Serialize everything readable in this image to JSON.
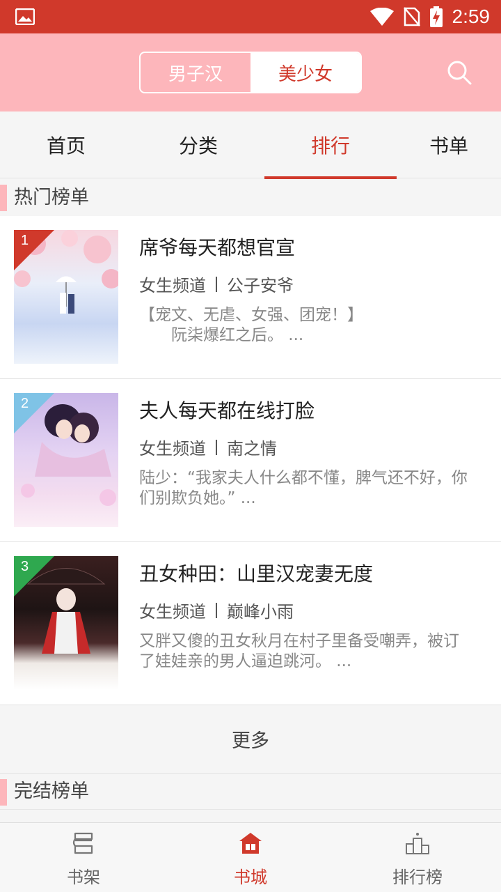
{
  "status_bar": {
    "time": "2:59"
  },
  "header": {
    "toggle": [
      {
        "label": "男子汉",
        "active": false
      },
      {
        "label": "美少女",
        "active": true
      }
    ]
  },
  "tabs": [
    {
      "label": "首页"
    },
    {
      "label": "分类"
    },
    {
      "label": "排行",
      "active": true
    },
    {
      "label": "书单"
    }
  ],
  "sections": {
    "hot": {
      "title": "热门榜单"
    },
    "finished": {
      "title": "完结榜单"
    }
  },
  "books": [
    {
      "rank": "1",
      "title": "席爷每天都想官宣",
      "channel": "女生频道",
      "author": "公子安爷",
      "desc_line1": "【宠文、无虐、女强、团宠！】",
      "desc_line2": "　　阮柒爆红之后。 ..."
    },
    {
      "rank": "2",
      "title": "夫人每天都在线打脸",
      "channel": "女生频道",
      "author": "南之情",
      "desc_line1": "陆少：“我家夫人什么都不懂，脾气还不好，你",
      "desc_line2": "们别欺负她。” ..."
    },
    {
      "rank": "3",
      "title": "丑女种田：山里汉宠妻无度",
      "channel": "女生频道",
      "author": "巅峰小雨",
      "desc_line1": "又胖又傻的丑女秋月在村子里备受嘲弄，被订",
      "desc_line2": "了娃娃亲的男人逼迫跳河。 ..."
    }
  ],
  "more_label": "更多",
  "bottom_nav": [
    {
      "label": "书架",
      "icon": "bookshelf-icon"
    },
    {
      "label": "书城",
      "icon": "bookstore-icon",
      "active": true
    },
    {
      "label": "排行榜",
      "icon": "ranking-icon"
    }
  ],
  "colors": {
    "accent": "#d0392b",
    "header_bg": "#fdb6bb"
  }
}
